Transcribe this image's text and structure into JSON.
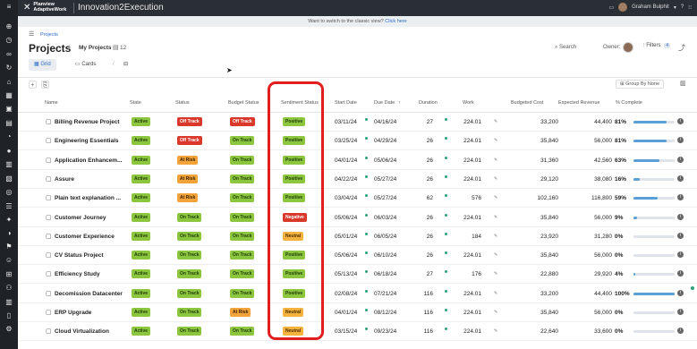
{
  "header": {
    "brand_line1": "Planview",
    "brand_line2": "AdaptiveWork",
    "app_title": "Innovation2Execution",
    "user_name": "Graham Bulphit"
  },
  "banner": {
    "text": "Want to switch to the classic view?",
    "link": "Click here"
  },
  "breadcrumb": {
    "item": "Projects"
  },
  "title_row": {
    "title": "Projects",
    "view_name": "My Projects",
    "count": "12",
    "search_label": "Search",
    "owner_label": "Owner:",
    "filters_label": "Filters",
    "filters_count": "4"
  },
  "tabs": [
    {
      "label": "Grid",
      "active": true
    },
    {
      "label": "Cards",
      "active": false
    }
  ],
  "toolbar": {
    "group_by": "Group By None"
  },
  "columns": {
    "name": "Name",
    "state": "State",
    "status": "Status",
    "budget_status": "Budget Status",
    "sentiment_status": "Sentiment Status",
    "start_date": "Start Date",
    "due_date": "Due Date",
    "duration": "Duration",
    "work": "Work",
    "budgeted_cost": "Budgeted Cost",
    "expected_revenue": "Expected Revenue",
    "pct_complete": "% Complete"
  },
  "rows": [
    {
      "name": "Billing Revenue Project",
      "state": "Active",
      "status": "Off Track",
      "status_color": "red",
      "budget": "Off Track",
      "budget_color": "red",
      "sentiment": "Positive",
      "sentiment_color": "green",
      "start": "03/11/24",
      "due": "04/16/24",
      "duration": "27",
      "work": "224.01",
      "budgeted_cost": "33,200",
      "expected_revenue": "44,400",
      "pct": "81%",
      "pct_value": 0.81
    },
    {
      "name": "Engineering Essentials",
      "state": "Active",
      "status": "Off Track",
      "status_color": "red",
      "budget": "On Track",
      "budget_color": "green",
      "sentiment": "Positive",
      "sentiment_color": "green",
      "start": "03/25/24",
      "due": "04/29/24",
      "duration": "26",
      "work": "224.01",
      "budgeted_cost": "35,840",
      "expected_revenue": "56,000",
      "pct": "81%",
      "pct_value": 0.81
    },
    {
      "name": "Application Enhancem...",
      "state": "Active",
      "status": "At Risk",
      "status_color": "amber",
      "budget": "On Track",
      "budget_color": "green",
      "sentiment": "Positive",
      "sentiment_color": "green",
      "start": "04/01/24",
      "due": "05/06/24",
      "duration": "26",
      "work": "224.01",
      "budgeted_cost": "31,360",
      "expected_revenue": "42,560",
      "pct": "63%",
      "pct_value": 0.63
    },
    {
      "name": "Assure",
      "state": "Active",
      "status": "At Risk",
      "status_color": "amber",
      "budget": "On Track",
      "budget_color": "green",
      "sentiment": "Positive",
      "sentiment_color": "green",
      "start": "04/22/24",
      "due": "05/27/24",
      "duration": "26",
      "work": "224.01",
      "budgeted_cost": "29,120",
      "expected_revenue": "38,080",
      "pct": "16%",
      "pct_value": 0.16
    },
    {
      "name": "Plain text explanation ...",
      "state": "Active",
      "status": "At Risk",
      "status_color": "amber",
      "budget": "On Track",
      "budget_color": "green",
      "sentiment": "Positive",
      "sentiment_color": "green",
      "start": "03/04/24",
      "due": "05/27/24",
      "duration": "62",
      "work": "576",
      "budgeted_cost": "102,160",
      "expected_revenue": "116,800",
      "pct": "59%",
      "pct_value": 0.59
    },
    {
      "name": "Customer Journey",
      "state": "Active",
      "status": "On Track",
      "status_color": "green",
      "budget": "On Track",
      "budget_color": "green",
      "sentiment": "Negative",
      "sentiment_color": "neg",
      "start": "05/06/24",
      "due": "06/03/24",
      "duration": "26",
      "work": "224.01",
      "budgeted_cost": "35,840",
      "expected_revenue": "56,000",
      "pct": "9%",
      "pct_value": 0.09
    },
    {
      "name": "Customer Experience",
      "state": "Active",
      "status": "On Track",
      "status_color": "green",
      "budget": "On Track",
      "budget_color": "green",
      "sentiment": "Neutral",
      "sentiment_color": "neutral",
      "start": "05/01/24",
      "due": "06/05/24",
      "duration": "26",
      "work": "184",
      "budgeted_cost": "23,920",
      "expected_revenue": "31,280",
      "pct": "0%",
      "pct_value": 0
    },
    {
      "name": "CV Status Project",
      "state": "Active",
      "status": "On Track",
      "status_color": "green",
      "budget": "On Track",
      "budget_color": "green",
      "sentiment": "Positive",
      "sentiment_color": "green",
      "start": "05/06/24",
      "due": "06/10/24",
      "duration": "26",
      "work": "224.01",
      "budgeted_cost": "35,840",
      "expected_revenue": "56,000",
      "pct": "0%",
      "pct_value": 0
    },
    {
      "name": "Efficiency Study",
      "state": "Active",
      "status": "On Track",
      "status_color": "green",
      "budget": "On Track",
      "budget_color": "green",
      "sentiment": "Positive",
      "sentiment_color": "green",
      "start": "05/13/24",
      "due": "06/18/24",
      "duration": "27",
      "work": "176",
      "budgeted_cost": "22,880",
      "expected_revenue": "29,920",
      "pct": "4%",
      "pct_value": 0.04
    },
    {
      "name": "Decomission Datacenter",
      "state": "Active",
      "status": "On Track",
      "status_color": "green",
      "budget": "On Track",
      "budget_color": "green",
      "sentiment": "Positive",
      "sentiment_color": "green",
      "start": "02/08/24",
      "due": "07/21/24",
      "duration": "116",
      "work": "224.01",
      "budgeted_cost": "33,200",
      "expected_revenue": "44,400",
      "pct": "100%",
      "pct_value": 1.0
    },
    {
      "name": "ERP Upgrade",
      "state": "Active",
      "status": "On Track",
      "status_color": "green",
      "budget": "At Risk",
      "budget_color": "amber",
      "sentiment": "Neutral",
      "sentiment_color": "neutral",
      "start": "04/01/24",
      "due": "08/12/24",
      "duration": "116",
      "work": "224.01",
      "budgeted_cost": "35,840",
      "expected_revenue": "56,000",
      "pct": "0%",
      "pct_value": 0
    },
    {
      "name": "Cloud Virtualization",
      "state": "Active",
      "status": "On Track",
      "status_color": "green",
      "budget": "On Track",
      "budget_color": "green",
      "sentiment": "Neutral",
      "sentiment_color": "neutral",
      "start": "03/15/24",
      "due": "09/23/24",
      "duration": "116",
      "work": "224.01",
      "budgeted_cost": "22,640",
      "expected_revenue": "33,600",
      "pct": "0%",
      "pct_value": 0
    }
  ]
}
